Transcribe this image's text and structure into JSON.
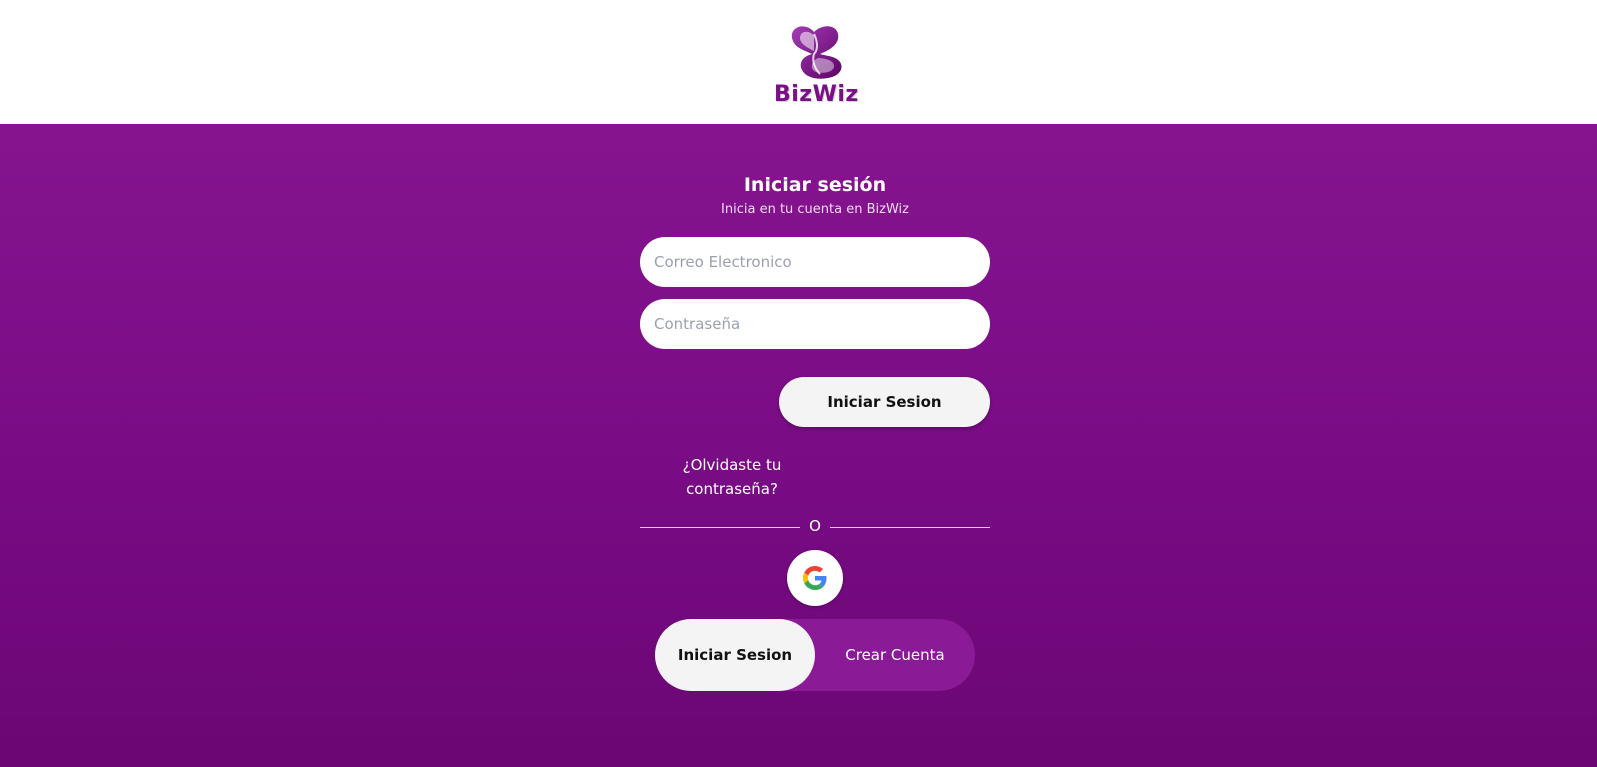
{
  "header": {
    "logo_text": "BizWiz"
  },
  "login": {
    "title": "Iniciar sesión",
    "subtitle": "Inicia en tu cuenta en BizWiz",
    "email_placeholder": "Correo Electronico",
    "email_value": "",
    "password_placeholder": "Contraseña",
    "password_value": "",
    "submit_label": "Iniciar Sesion",
    "forgot_label": "¿Olvidaste tu contraseña?",
    "divider_text": "O",
    "google_icon": "google-icon"
  },
  "mode_toggle": {
    "login_label": "Iniciar Sesion",
    "create_label": "Crear Cuenta",
    "selected": "login"
  },
  "colors": {
    "brand_purple": "#7a0f88",
    "background_top": "#86148f",
    "background_bottom": "#6b0674",
    "button_light": "#f4f4f4"
  }
}
